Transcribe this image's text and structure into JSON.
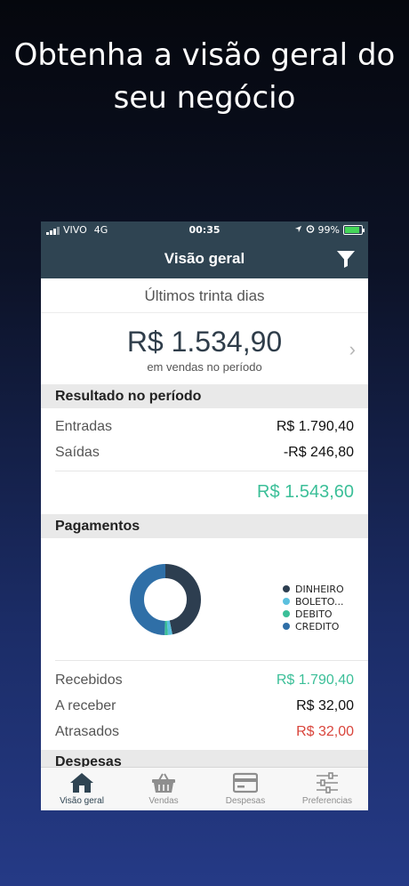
{
  "promo": {
    "line1": "Obtenha a visão geral do",
    "line2": "seu negócio"
  },
  "status_bar": {
    "carrier": "VIVO",
    "network": "4G",
    "time": "00:35",
    "battery": "99%"
  },
  "nav": {
    "title": "Visão geral",
    "filter_icon": "filter-icon"
  },
  "period": {
    "label": "Últimos trinta dias"
  },
  "sales": {
    "total": "R$ 1.534,90",
    "caption": "em vendas no período"
  },
  "result": {
    "header": "Resultado no período",
    "rows": [
      {
        "label": "Entradas",
        "value": "R$ 1.790,40"
      },
      {
        "label": "Saídas",
        "value": "-R$ 246,80"
      }
    ],
    "total": "R$ 1.543,60"
  },
  "payments": {
    "header": "Pagamentos",
    "legend": [
      {
        "label": "DINHEIRO",
        "color": "#2d3e50"
      },
      {
        "label": "BOLETO...",
        "color": "#5bc0de"
      },
      {
        "label": "DEBITO",
        "color": "#3bbf98"
      },
      {
        "label": "CREDITO",
        "color": "#2f6fa7"
      }
    ],
    "rows": [
      {
        "label": "Recebidos",
        "value": "R$ 1.790,40"
      },
      {
        "label": "A receber",
        "value": "R$ 32,00"
      },
      {
        "label": "Atrasados",
        "value": "R$ 32,00"
      }
    ]
  },
  "expenses": {
    "header": "Despesas"
  },
  "tabs": [
    {
      "label": "Visão geral",
      "icon": "home-icon"
    },
    {
      "label": "Vendas",
      "icon": "basket-icon"
    },
    {
      "label": "Despesas",
      "icon": "card-icon"
    },
    {
      "label": "Preferencias",
      "icon": "sliders-icon"
    }
  ],
  "colors": {
    "navbar": "#2f4452",
    "positive": "#3bbf98",
    "negative": "#d9453c"
  }
}
